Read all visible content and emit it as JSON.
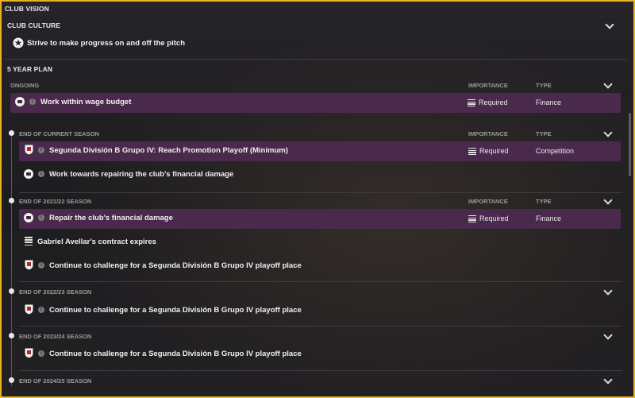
{
  "panel": {
    "title": "CLUB VISION",
    "culture_header": "CLUB CULTURE",
    "culture_text": "Strive to make progress on and off the pitch",
    "plan_header": "5 YEAR PLAN"
  },
  "columns": {
    "importance": "IMPORTANCE",
    "type": "TYPE"
  },
  "sections": [
    {
      "header": "ONGOING",
      "rows": [
        {
          "label": "Work within wage budget",
          "importance": "Required",
          "type": "Finance"
        }
      ]
    },
    {
      "header": "END OF CURRENT SEASON",
      "rows": [
        {
          "label": "Segunda División B Grupo IV: Reach Promotion Playoff (Minimum)",
          "importance": "Required",
          "type": "Competition"
        },
        {
          "label": "Work towards repairing the club's financial damage"
        }
      ]
    },
    {
      "header": "END OF 2021/22 SEASON",
      "rows": [
        {
          "label": "Repair the club's financial damage",
          "importance": "Required",
          "type": "Finance"
        },
        {
          "label": "Gabriel Avellar's contract expires"
        },
        {
          "label": "Continue to challenge for a Segunda División B Grupo IV playoff place"
        }
      ]
    },
    {
      "header": "END OF 2022/23 SEASON",
      "rows": [
        {
          "label": "Continue to challenge for a Segunda División B Grupo IV playoff place"
        }
      ]
    },
    {
      "header": "END OF 2023/24 SEASON",
      "rows": [
        {
          "label": "Continue to challenge for a Segunda División B Grupo IV playoff place"
        }
      ]
    },
    {
      "header": "END OF 2024/25 SEASON",
      "rows": []
    }
  ],
  "colors": {
    "border": "#e6b422",
    "highlight_row": "#4a2a4c",
    "background": "#1d1c1f"
  }
}
